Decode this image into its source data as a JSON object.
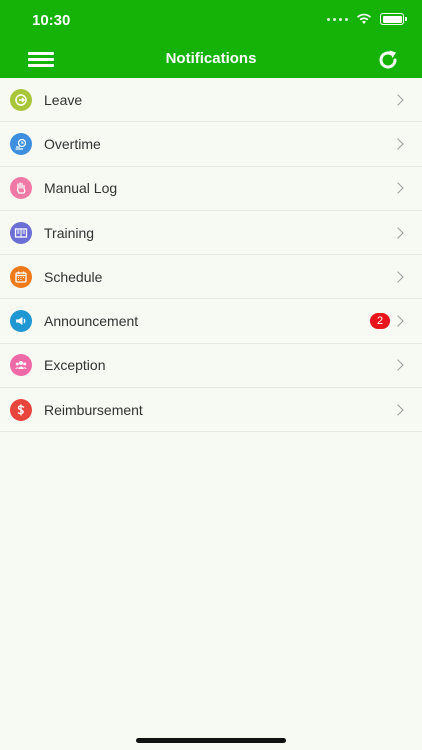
{
  "status_bar": {
    "time": "10:30"
  },
  "header": {
    "title": "Notifications"
  },
  "colors": {
    "brand": "#15b308",
    "badge": "#e8141c"
  },
  "items": [
    {
      "label": "Leave",
      "icon": "exit-icon",
      "color": "#a9c53a",
      "badge": ""
    },
    {
      "label": "Overtime",
      "icon": "overtime-icon",
      "color": "#3e8fe0",
      "badge": ""
    },
    {
      "label": "Manual Log",
      "icon": "hand-icon",
      "color": "#f07aa5",
      "badge": ""
    },
    {
      "label": "Training",
      "icon": "book-icon",
      "color": "#6b6fd4",
      "badge": ""
    },
    {
      "label": "Schedule",
      "icon": "calendar-icon",
      "color": "#ee7a1a",
      "badge": ""
    },
    {
      "label": "Announcement",
      "icon": "megaphone-icon",
      "color": "#1f97d3",
      "badge": "2"
    },
    {
      "label": "Exception",
      "icon": "users-icon",
      "color": "#f06aa8",
      "badge": ""
    },
    {
      "label": "Reimbursement",
      "icon": "dollar-icon",
      "color": "#e8453c",
      "badge": ""
    }
  ]
}
